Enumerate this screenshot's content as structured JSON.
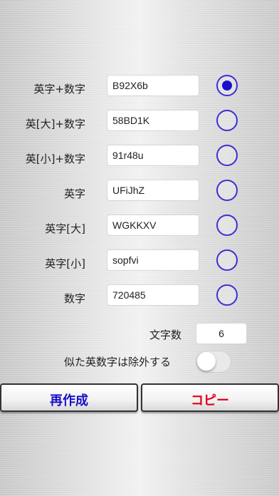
{
  "rows": [
    {
      "label": "英字+数字",
      "value": "B92X6b",
      "selected": true
    },
    {
      "label": "英[大]+数字",
      "value": "58BD1K",
      "selected": false
    },
    {
      "label": "英[小]+数字",
      "value": "91r48u",
      "selected": false
    },
    {
      "label": "英字",
      "value": "UFiJhZ",
      "selected": false
    },
    {
      "label": "英字[大]",
      "value": "WGKKXV",
      "selected": false
    },
    {
      "label": "英字[小]",
      "value": "sopfvi",
      "selected": false
    },
    {
      "label": "数字",
      "value": "720485",
      "selected": false
    }
  ],
  "length": {
    "label": "文字数",
    "value": "6"
  },
  "exclude_similar": {
    "label": "似た英数字は除外する",
    "on": false
  },
  "buttons": {
    "regenerate": "再作成",
    "copy": "コピー"
  },
  "colors": {
    "accent": "#1a10c8",
    "copy": "#e0001a"
  }
}
